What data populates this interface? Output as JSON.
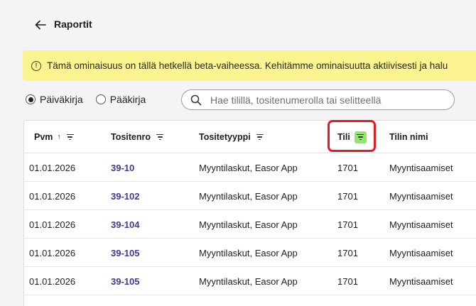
{
  "header": {
    "title": "Raportit"
  },
  "banner": {
    "text": "Tämä ominaisuus on tällä hetkellä beta-vaiheessa. Kehitämme ominaisuutta aktiivisesti ja halu"
  },
  "view_options": {
    "selected": "Päiväkirja",
    "options": [
      "Päiväkirja",
      "Pääkirja"
    ]
  },
  "search": {
    "placeholder": "Hae tilillä, tositenumerolla tai selitteellä",
    "value": ""
  },
  "table": {
    "columns": [
      "Pvm",
      "Tositenro",
      "Tositetyyppi",
      "Tili",
      "Tilin nimi"
    ],
    "sort": {
      "column": "Pvm",
      "direction": "ascending",
      "icon": "arrow-up-icon"
    },
    "active_filter": {
      "column": "Tili",
      "color": "#8ee76a"
    },
    "rows": [
      {
        "pvm": "01.01.2026",
        "tositenro": "39-10",
        "tositetyyppi": "Myyntilaskut, Easor App",
        "tili": "1701",
        "tilin_nimi": "Myyntisaamiset"
      },
      {
        "pvm": "01.01.2026",
        "tositenro": "39-102",
        "tositetyyppi": "Myyntilaskut, Easor App",
        "tili": "1701",
        "tilin_nimi": "Myyntisaamiset"
      },
      {
        "pvm": "01.01.2026",
        "tositenro": "39-104",
        "tositetyyppi": "Myyntilaskut, Easor App",
        "tili": "1701",
        "tilin_nimi": "Myyntisaamiset"
      },
      {
        "pvm": "01.01.2026",
        "tositenro": "39-105",
        "tositetyyppi": "Myyntilaskut, Easor App",
        "tili": "1701",
        "tilin_nimi": "Myyntisaamiset"
      },
      {
        "pvm": "01.01.2026",
        "tositenro": "39-105",
        "tositetyyppi": "Myyntilaskut, Easor App",
        "tili": "1701",
        "tilin_nimi": "Myyntisaamiset"
      }
    ]
  },
  "colors": {
    "banner_bg": "#fbf38f",
    "link": "#3f3a8f",
    "highlight": "#e41c1c"
  }
}
